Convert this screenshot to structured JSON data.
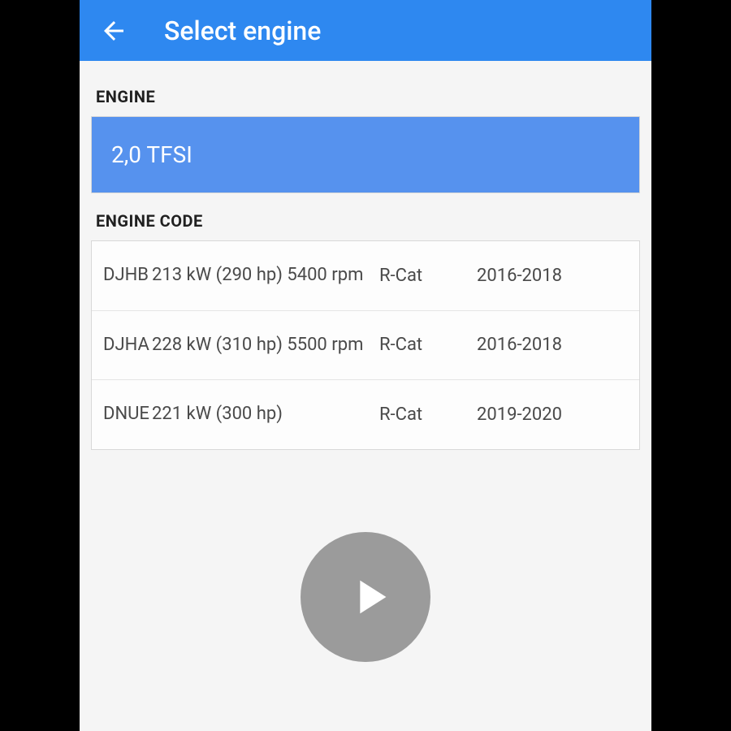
{
  "header": {
    "title": "Select engine"
  },
  "sections": {
    "engine_label": "ENGINE",
    "engine_code_label": "ENGINE CODE"
  },
  "engine": {
    "selected": "2,0 TFSI"
  },
  "codes": [
    {
      "code": "DJHB",
      "power": "213 kW (290 hp) 5400 rpm",
      "cat": "R-Cat",
      "years": "2016-2018"
    },
    {
      "code": "DJHA",
      "power": "228 kW (310 hp) 5500 rpm",
      "cat": "R-Cat",
      "years": "2016-2018"
    },
    {
      "code": "DNUE",
      "power": "221 kW (300 hp)",
      "cat": "R-Cat",
      "years": "2019-2020"
    }
  ]
}
